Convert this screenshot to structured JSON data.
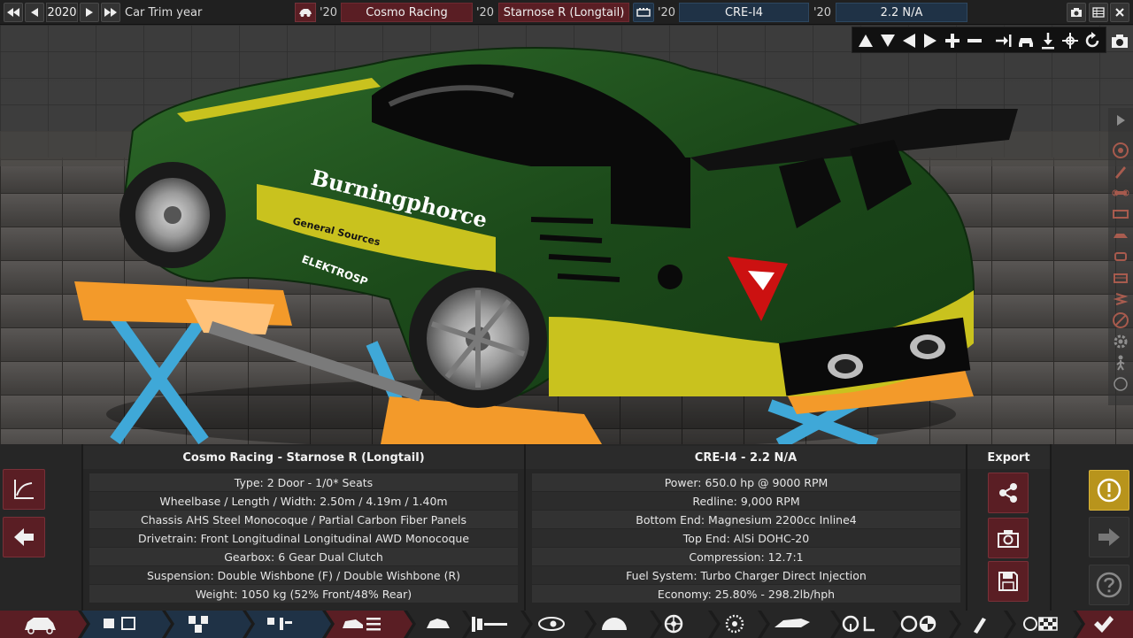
{
  "topbar": {
    "year": "2020",
    "trim_year_label": "Car Trim year",
    "model_year": "'20",
    "company": "Cosmo Racing",
    "trim_year": "'20",
    "trim": "Starnose R (Longtail)",
    "engine_year": "'20",
    "engine_family": "CRE-I4",
    "variant_year": "'20",
    "variant": "2.2 N/A"
  },
  "car": {
    "sponsor_main": "Burningphorce",
    "sponsor_secondary": "General Sources",
    "sponsor_side": "ELEKTROSP"
  },
  "car_panel": {
    "title": "Cosmo Racing - Starnose R (Longtail)",
    "rows": [
      "Type: 2 Door - 1/0* Seats",
      "Wheelbase / Length / Width: 2.50m / 4.19m / 1.40m",
      "Chassis AHS Steel Monocoque / Partial Carbon Fiber Panels",
      "Drivetrain: Front Longitudinal Longitudinal AWD Monocoque",
      "Gearbox: 6 Gear Dual Clutch",
      "Suspension: Double Wishbone (F) / Double Wishbone (R)",
      "Weight: 1050 kg (52% Front/48% Rear)"
    ]
  },
  "engine_panel": {
    "title": "CRE-I4 - 2.2 N/A",
    "rows": [
      "Power: 650.0 hp @ 9000 RPM",
      "Redline:  9,000 RPM",
      "Bottom End: Magnesium 2200cc Inline4",
      "Top End: AlSi DOHC-20",
      "Compression: 12.7:1",
      "Fuel System: Turbo Charger Direct Injection",
      "Economy: 25.80% - 298.2lb/hph"
    ]
  },
  "export": {
    "title": "Export"
  },
  "colors": {
    "accent_red": "#5a1e24",
    "accent_blue": "#1f3246",
    "warning_gold": "#b8941c",
    "car_green": "#1f4d1c",
    "car_yellow": "#c9c21e"
  }
}
